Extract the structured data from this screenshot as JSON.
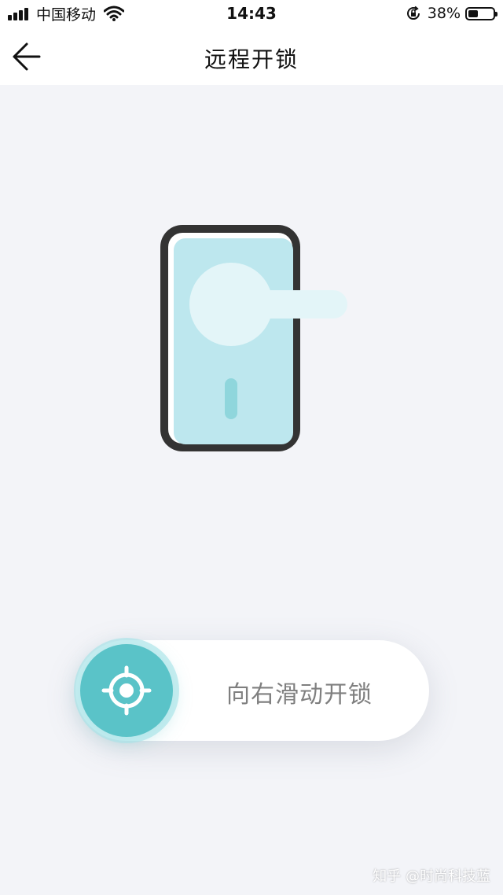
{
  "status_bar": {
    "carrier": "中国移动",
    "time": "14:43",
    "battery_percent": "38%",
    "battery_level": 0.38,
    "icons": [
      "signal-icon",
      "wifi-icon",
      "orientation-lock-icon",
      "battery-icon"
    ]
  },
  "nav": {
    "title": "远程开锁",
    "back_icon": "arrow-left-icon"
  },
  "illustration": {
    "name": "door-lock-illustration",
    "colors": {
      "frame": "#333333",
      "panel": "#bde7ee",
      "handle": "#e3f5f8",
      "keyhole": "#8fd6dc"
    }
  },
  "slider": {
    "label": "向右滑动开锁",
    "knob_icon": "crosshair-icon",
    "accent": "#5ac3c8"
  },
  "watermark": "知乎 @时尚科技蓝",
  "colors": {
    "background": "#f3f4f8",
    "bar": "#ffffff"
  }
}
